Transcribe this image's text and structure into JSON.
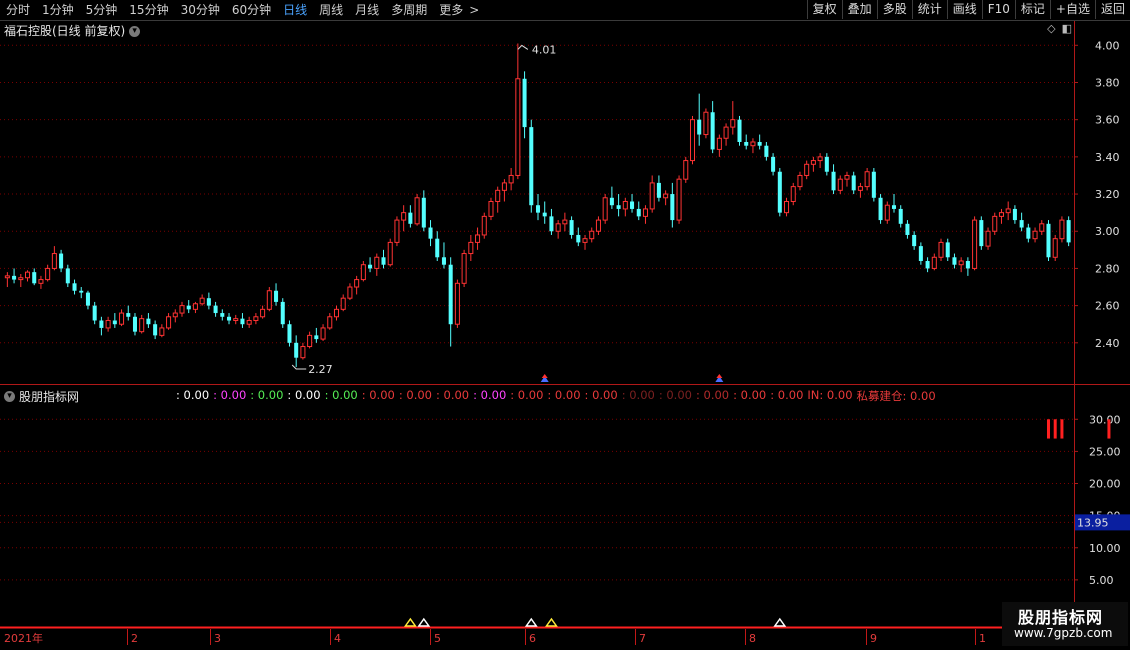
{
  "toolbar": {
    "periods": [
      "分时",
      "1分钟",
      "5分钟",
      "15分钟",
      "30分钟",
      "60分钟",
      "日线",
      "周线",
      "月线",
      "多周期",
      "更多"
    ],
    "more_chevron": ">",
    "buttons": [
      "复权",
      "叠加",
      "多股",
      "统计",
      "画线",
      "F10",
      "标记",
      "+自选",
      "返回"
    ]
  },
  "price_panel": {
    "title": "福石控股(日线 前复权)",
    "high_label": "4.01",
    "low_label": "2.27",
    "y_ticks": [
      "4.00",
      "3.80",
      "3.60",
      "3.40",
      "3.20",
      "3.00",
      "2.80",
      "2.60",
      "2.40"
    ]
  },
  "indicator_panel": {
    "title": "股朋指标网",
    "values": [
      {
        "text": ": 0.00",
        "color": "#ffffff"
      },
      {
        "text": ": 0.00",
        "color": "#ff44ff"
      },
      {
        "text": ": 0.00",
        "color": "#55ee55"
      },
      {
        "text": ": 0.00",
        "color": "#ffffff"
      },
      {
        "text": ": 0.00",
        "color": "#55ee55"
      },
      {
        "text": ": 0.00",
        "color": "#e83a3a"
      },
      {
        "text": ": 0.00",
        "color": "#e83a3a"
      },
      {
        "text": ": 0.00",
        "color": "#e83a3a"
      },
      {
        "text": ": 0.00",
        "color": "#ff44ff"
      },
      {
        "text": ": 0.00",
        "color": "#e83a3a"
      },
      {
        "text": ": 0.00",
        "color": "#e83a3a"
      },
      {
        "text": ": 0.00",
        "color": "#e83a3a"
      },
      {
        "text": ": 0.00",
        "color": "#7a2020"
      },
      {
        "text": ": 0.00",
        "color": "#7a2020"
      },
      {
        "text": ": 0.00",
        "color": "#b02a2a"
      },
      {
        "text": ": 0.00",
        "color": "#e83a3a"
      },
      {
        "text": ": 0.00",
        "color": "#e83a3a"
      },
      {
        "text": "IN: 0.00",
        "color": "#e83a3a"
      },
      {
        "text": "私募建仓: 0.00",
        "color": "#e83a3a"
      }
    ],
    "y_ticks": [
      "30.00",
      "25.00",
      "20.00",
      "15.00",
      "10.00",
      "5.00"
    ],
    "current_value": "13.95"
  },
  "x_axis": {
    "labels": [
      "2021年",
      "2",
      "3",
      "4",
      "5",
      "6",
      "7",
      "8",
      "9",
      "1"
    ]
  },
  "watermark": {
    "title": "股朋指标网",
    "url": "www.7gpzb.com"
  },
  "colors": {
    "up": "#ff3333",
    "down": "#54ffff",
    "grid": "#7a0000",
    "axis": "#b01818"
  },
  "chart_data": {
    "type": "candlestick",
    "ylim": [
      2.2,
      4.05
    ],
    "candles": [
      [
        2.75,
        2.78,
        2.7,
        2.76
      ],
      [
        2.76,
        2.8,
        2.72,
        2.74
      ],
      [
        2.74,
        2.77,
        2.7,
        2.75
      ],
      [
        2.75,
        2.79,
        2.73,
        2.78
      ],
      [
        2.78,
        2.8,
        2.71,
        2.72
      ],
      [
        2.72,
        2.76,
        2.69,
        2.74
      ],
      [
        2.74,
        2.82,
        2.73,
        2.8
      ],
      [
        2.8,
        2.92,
        2.79,
        2.88
      ],
      [
        2.88,
        2.9,
        2.78,
        2.8
      ],
      [
        2.8,
        2.82,
        2.7,
        2.72
      ],
      [
        2.72,
        2.74,
        2.66,
        2.68
      ],
      [
        2.68,
        2.7,
        2.64,
        2.67
      ],
      [
        2.67,
        2.68,
        2.58,
        2.6
      ],
      [
        2.6,
        2.62,
        2.5,
        2.52
      ],
      [
        2.52,
        2.54,
        2.44,
        2.48
      ],
      [
        2.48,
        2.54,
        2.46,
        2.52
      ],
      [
        2.52,
        2.56,
        2.48,
        2.5
      ],
      [
        2.5,
        2.58,
        2.49,
        2.56
      ],
      [
        2.56,
        2.6,
        2.52,
        2.54
      ],
      [
        2.54,
        2.56,
        2.44,
        2.46
      ],
      [
        2.46,
        2.55,
        2.45,
        2.53
      ],
      [
        2.53,
        2.56,
        2.48,
        2.5
      ],
      [
        2.5,
        2.52,
        2.42,
        2.44
      ],
      [
        2.44,
        2.5,
        2.43,
        2.48
      ],
      [
        2.48,
        2.56,
        2.47,
        2.54
      ],
      [
        2.54,
        2.58,
        2.51,
        2.56
      ],
      [
        2.56,
        2.62,
        2.54,
        2.6
      ],
      [
        2.6,
        2.63,
        2.56,
        2.58
      ],
      [
        2.58,
        2.62,
        2.56,
        2.61
      ],
      [
        2.61,
        2.66,
        2.6,
        2.64
      ],
      [
        2.64,
        2.67,
        2.58,
        2.6
      ],
      [
        2.6,
        2.62,
        2.54,
        2.56
      ],
      [
        2.56,
        2.58,
        2.52,
        2.54
      ],
      [
        2.54,
        2.56,
        2.5,
        2.52
      ],
      [
        2.52,
        2.55,
        2.5,
        2.53
      ],
      [
        2.53,
        2.56,
        2.48,
        2.5
      ],
      [
        2.5,
        2.54,
        2.48,
        2.52
      ],
      [
        2.52,
        2.56,
        2.5,
        2.54
      ],
      [
        2.54,
        2.6,
        2.53,
        2.58
      ],
      [
        2.58,
        2.7,
        2.57,
        2.68
      ],
      [
        2.68,
        2.72,
        2.6,
        2.62
      ],
      [
        2.62,
        2.64,
        2.48,
        2.5
      ],
      [
        2.5,
        2.52,
        2.38,
        2.4
      ],
      [
        2.4,
        2.44,
        2.27,
        2.32
      ],
      [
        2.32,
        2.4,
        2.31,
        2.38
      ],
      [
        2.38,
        2.46,
        2.37,
        2.44
      ],
      [
        2.44,
        2.48,
        2.4,
        2.42
      ],
      [
        2.42,
        2.5,
        2.41,
        2.48
      ],
      [
        2.48,
        2.56,
        2.47,
        2.54
      ],
      [
        2.54,
        2.6,
        2.52,
        2.58
      ],
      [
        2.58,
        2.66,
        2.57,
        2.64
      ],
      [
        2.64,
        2.72,
        2.63,
        2.7
      ],
      [
        2.7,
        2.76,
        2.66,
        2.74
      ],
      [
        2.74,
        2.84,
        2.73,
        2.82
      ],
      [
        2.82,
        2.86,
        2.78,
        2.8
      ],
      [
        2.8,
        2.88,
        2.76,
        2.86
      ],
      [
        2.86,
        2.9,
        2.8,
        2.82
      ],
      [
        2.82,
        2.96,
        2.81,
        2.94
      ],
      [
        2.94,
        3.08,
        2.92,
        3.06
      ],
      [
        3.06,
        3.14,
        3.0,
        3.1
      ],
      [
        3.1,
        3.14,
        3.02,
        3.04
      ],
      [
        3.04,
        3.2,
        3.03,
        3.18
      ],
      [
        3.18,
        3.22,
        3.0,
        3.02
      ],
      [
        3.02,
        3.06,
        2.92,
        2.96
      ],
      [
        2.96,
        3.0,
        2.84,
        2.86
      ],
      [
        2.86,
        2.94,
        2.8,
        2.82
      ],
      [
        2.82,
        2.86,
        2.38,
        2.5
      ],
      [
        2.5,
        2.74,
        2.48,
        2.72
      ],
      [
        2.72,
        2.9,
        2.7,
        2.88
      ],
      [
        2.88,
        2.98,
        2.84,
        2.94
      ],
      [
        2.94,
        3.02,
        2.9,
        2.98
      ],
      [
        2.98,
        3.1,
        2.96,
        3.08
      ],
      [
        3.08,
        3.18,
        3.06,
        3.16
      ],
      [
        3.16,
        3.24,
        3.1,
        3.22
      ],
      [
        3.22,
        3.28,
        3.16,
        3.26
      ],
      [
        3.26,
        3.34,
        3.22,
        3.3
      ],
      [
        3.3,
        4.01,
        3.28,
        3.82
      ],
      [
        3.82,
        3.86,
        3.5,
        3.56
      ],
      [
        3.56,
        3.6,
        3.1,
        3.14
      ],
      [
        3.14,
        3.2,
        3.06,
        3.1
      ],
      [
        3.1,
        3.16,
        3.04,
        3.08
      ],
      [
        3.08,
        3.12,
        2.98,
        3.0
      ],
      [
        3.0,
        3.06,
        2.96,
        3.04
      ],
      [
        3.04,
        3.1,
        3.0,
        3.06
      ],
      [
        3.06,
        3.08,
        2.96,
        2.98
      ],
      [
        2.98,
        3.02,
        2.92,
        2.94
      ],
      [
        2.94,
        2.98,
        2.9,
        2.96
      ],
      [
        2.96,
        3.02,
        2.94,
        3.0
      ],
      [
        3.0,
        3.08,
        2.98,
        3.06
      ],
      [
        3.06,
        3.2,
        3.04,
        3.18
      ],
      [
        3.18,
        3.24,
        3.12,
        3.14
      ],
      [
        3.14,
        3.2,
        3.08,
        3.12
      ],
      [
        3.12,
        3.18,
        3.08,
        3.16
      ],
      [
        3.16,
        3.2,
        3.1,
        3.12
      ],
      [
        3.12,
        3.16,
        3.06,
        3.08
      ],
      [
        3.08,
        3.14,
        3.04,
        3.12
      ],
      [
        3.12,
        3.3,
        3.1,
        3.26
      ],
      [
        3.26,
        3.3,
        3.16,
        3.18
      ],
      [
        3.18,
        3.22,
        3.14,
        3.2
      ],
      [
        3.2,
        3.26,
        3.02,
        3.06
      ],
      [
        3.06,
        3.3,
        3.04,
        3.28
      ],
      [
        3.28,
        3.4,
        3.26,
        3.38
      ],
      [
        3.38,
        3.62,
        3.36,
        3.6
      ],
      [
        3.6,
        3.74,
        3.46,
        3.52
      ],
      [
        3.52,
        3.66,
        3.5,
        3.64
      ],
      [
        3.64,
        3.7,
        3.42,
        3.44
      ],
      [
        3.44,
        3.52,
        3.4,
        3.5
      ],
      [
        3.5,
        3.58,
        3.46,
        3.56
      ],
      [
        3.56,
        3.7,
        3.52,
        3.6
      ],
      [
        3.6,
        3.62,
        3.46,
        3.48
      ],
      [
        3.48,
        3.52,
        3.44,
        3.46
      ],
      [
        3.46,
        3.5,
        3.42,
        3.48
      ],
      [
        3.48,
        3.52,
        3.44,
        3.46
      ],
      [
        3.46,
        3.48,
        3.38,
        3.4
      ],
      [
        3.4,
        3.42,
        3.3,
        3.32
      ],
      [
        3.32,
        3.34,
        3.08,
        3.1
      ],
      [
        3.1,
        3.18,
        3.08,
        3.16
      ],
      [
        3.16,
        3.26,
        3.14,
        3.24
      ],
      [
        3.24,
        3.32,
        3.22,
        3.3
      ],
      [
        3.3,
        3.38,
        3.28,
        3.36
      ],
      [
        3.36,
        3.4,
        3.32,
        3.38
      ],
      [
        3.38,
        3.42,
        3.34,
        3.4
      ],
      [
        3.4,
        3.42,
        3.3,
        3.32
      ],
      [
        3.32,
        3.36,
        3.2,
        3.22
      ],
      [
        3.22,
        3.3,
        3.2,
        3.28
      ],
      [
        3.28,
        3.32,
        3.24,
        3.3
      ],
      [
        3.3,
        3.32,
        3.2,
        3.22
      ],
      [
        3.22,
        3.26,
        3.18,
        3.24
      ],
      [
        3.24,
        3.34,
        3.22,
        3.32
      ],
      [
        3.32,
        3.34,
        3.16,
        3.18
      ],
      [
        3.18,
        3.2,
        3.04,
        3.06
      ],
      [
        3.06,
        3.16,
        3.04,
        3.14
      ],
      [
        3.14,
        3.2,
        3.1,
        3.12
      ],
      [
        3.12,
        3.14,
        3.02,
        3.04
      ],
      [
        3.04,
        3.06,
        2.96,
        2.98
      ],
      [
        2.98,
        3.0,
        2.9,
        2.92
      ],
      [
        2.92,
        2.94,
        2.82,
        2.84
      ],
      [
        2.84,
        2.86,
        2.78,
        2.8
      ],
      [
        2.8,
        2.88,
        2.79,
        2.86
      ],
      [
        2.86,
        2.96,
        2.84,
        2.94
      ],
      [
        2.94,
        2.96,
        2.84,
        2.86
      ],
      [
        2.86,
        2.88,
        2.8,
        2.82
      ],
      [
        2.82,
        2.86,
        2.78,
        2.84
      ],
      [
        2.84,
        2.86,
        2.76,
        2.8
      ],
      [
        2.8,
        3.08,
        2.79,
        3.06
      ],
      [
        3.06,
        3.08,
        2.9,
        2.92
      ],
      [
        2.92,
        3.02,
        2.9,
        3.0
      ],
      [
        3.0,
        3.1,
        2.98,
        3.08
      ],
      [
        3.08,
        3.12,
        3.04,
        3.1
      ],
      [
        3.1,
        3.16,
        3.06,
        3.12
      ],
      [
        3.12,
        3.14,
        3.04,
        3.06
      ],
      [
        3.06,
        3.1,
        3.0,
        3.02
      ],
      [
        3.02,
        3.04,
        2.94,
        2.96
      ],
      [
        2.96,
        3.02,
        2.94,
        3.0
      ],
      [
        3.0,
        3.06,
        2.98,
        3.04
      ],
      [
        3.04,
        3.06,
        2.84,
        2.86
      ],
      [
        2.86,
        2.98,
        2.84,
        2.96
      ],
      [
        2.96,
        3.08,
        2.94,
        3.06
      ],
      [
        3.06,
        3.08,
        2.92,
        2.94
      ]
    ],
    "signals_bottom": [
      {
        "index": 60,
        "color": "#ffeb3b"
      },
      {
        "index": 62,
        "color": "#ffffff"
      },
      {
        "index": 78,
        "color": "#ffffff"
      },
      {
        "index": 81,
        "color": "#ffeb3b"
      },
      {
        "index": 115,
        "color": "#ffffff"
      },
      {
        "index": 155,
        "color": "#ff3333"
      },
      {
        "index": 164,
        "color": "#ff3333"
      }
    ],
    "red_bars_indicator": [
      {
        "index": 155,
        "value": 30
      },
      {
        "index": 156,
        "value": 30
      },
      {
        "index": 157,
        "value": 30
      },
      {
        "index": 164,
        "value": 30
      }
    ]
  }
}
